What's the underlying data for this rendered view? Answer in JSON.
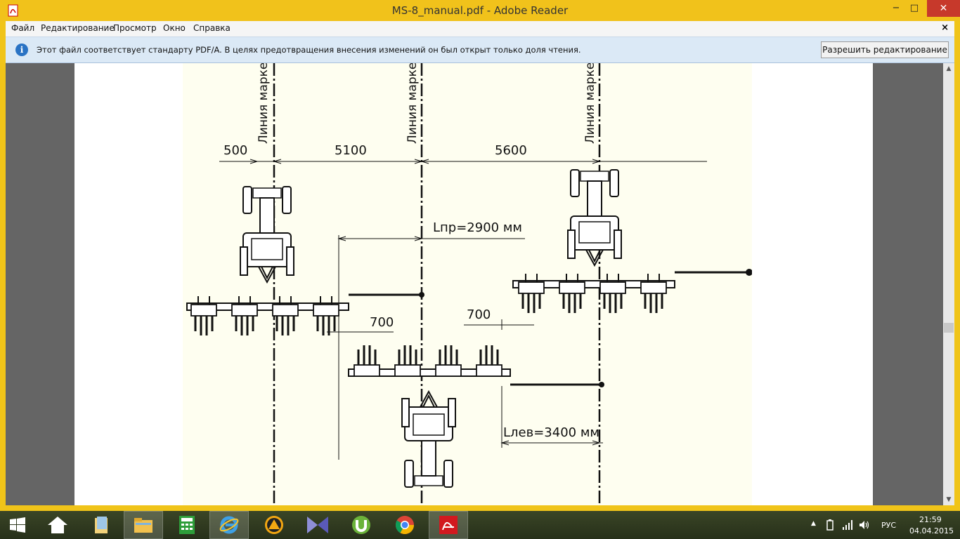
{
  "window": {
    "title": "MS-8_manual.pdf - Adobe Reader",
    "minimize": "−",
    "maximize": "□",
    "close": "✕"
  },
  "menu": {
    "items": [
      "Файл",
      "Редактирование",
      "Просмотр",
      "Окно",
      "Справка"
    ],
    "close": "×"
  },
  "infobar": {
    "text": "Этот файл соответствует стандарту PDF/A. В целях предотвращения внесения изменений он был открыт только доля чтения.",
    "button": "Разрешить редактирование"
  },
  "drawing": {
    "line_label": "Линия марке",
    "dim_500": "500",
    "dim_5100": "5100",
    "dim_5600": "5600",
    "dim_lpr": "Lпр=2900 мм",
    "dim_700_left": "700",
    "dim_700_right": "700",
    "dim_llev": "Lлев=3400 мм"
  },
  "taskbar": {
    "apps": [
      "start-icon",
      "home-icon",
      "file-explorer-icon",
      "folder-icon",
      "calculator-icon",
      "internet-explorer-icon",
      "app-icon",
      "media-player-icon",
      "utorrent-icon",
      "chrome-icon",
      "adobe-reader-icon"
    ],
    "tray_lang": "РУС",
    "time": "21:59",
    "date": "04.04.2015"
  }
}
